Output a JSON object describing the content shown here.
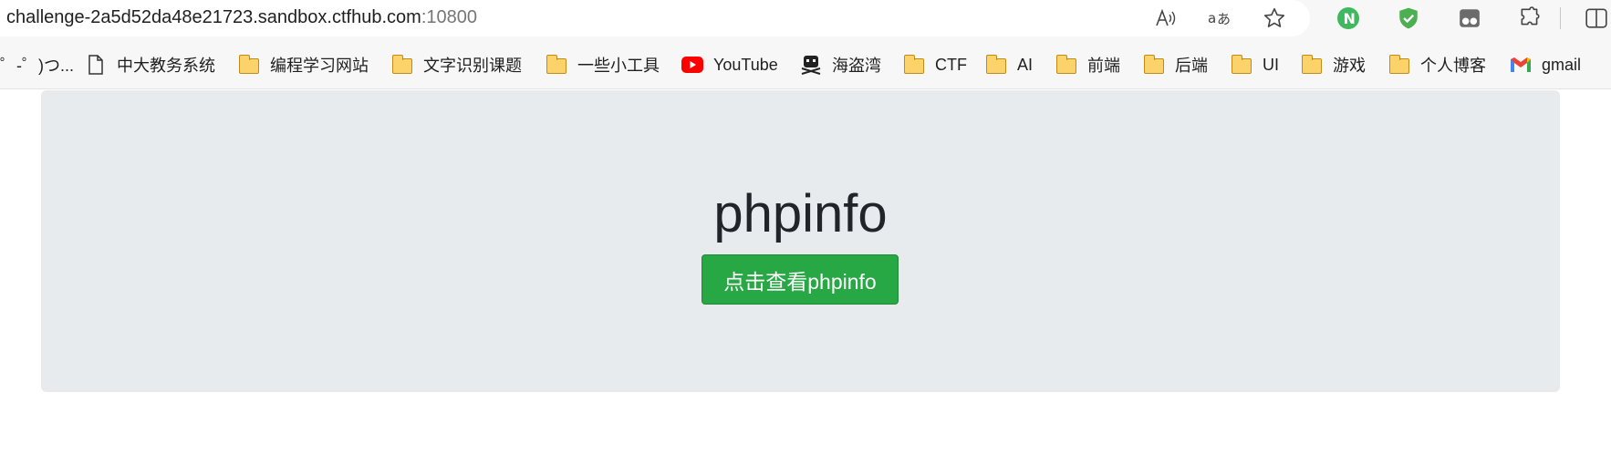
{
  "browser": {
    "url_host": "challenge-2a5d52da48e21723.sandbox.ctfhub.com",
    "url_port": ":10800",
    "icons": [
      "read-aloud-icon",
      "translate-icon",
      "favorite-star-icon",
      "extension-n-icon",
      "shield-extension-icon",
      "extension-icon",
      "puzzle-extensions-icon",
      "split-screen-icon"
    ]
  },
  "bookmarks": [
    {
      "label": "゜-゜)つ...",
      "icon": "none"
    },
    {
      "label": "中大教务系统",
      "icon": "page-icon"
    },
    {
      "label": "编程学习网站",
      "icon": "folder-icon"
    },
    {
      "label": "文字识别课题",
      "icon": "folder-icon"
    },
    {
      "label": "一些小工具",
      "icon": "folder-icon"
    },
    {
      "label": "YouTube",
      "icon": "youtube-icon"
    },
    {
      "label": "海盗湾",
      "icon": "pirate-icon"
    },
    {
      "label": "CTF",
      "icon": "folder-icon"
    },
    {
      "label": "AI",
      "icon": "folder-icon"
    },
    {
      "label": "前端",
      "icon": "folder-icon"
    },
    {
      "label": "后端",
      "icon": "folder-icon"
    },
    {
      "label": "UI",
      "icon": "folder-icon"
    },
    {
      "label": "游戏",
      "icon": "folder-icon"
    },
    {
      "label": "个人博客",
      "icon": "folder-icon"
    },
    {
      "label": "gmail",
      "icon": "gmail-icon"
    }
  ],
  "page": {
    "title": "phpinfo",
    "button_label": "点击查看phpinfo",
    "button_color": "#28a745",
    "jumbotron_color": "#e8ebee"
  }
}
